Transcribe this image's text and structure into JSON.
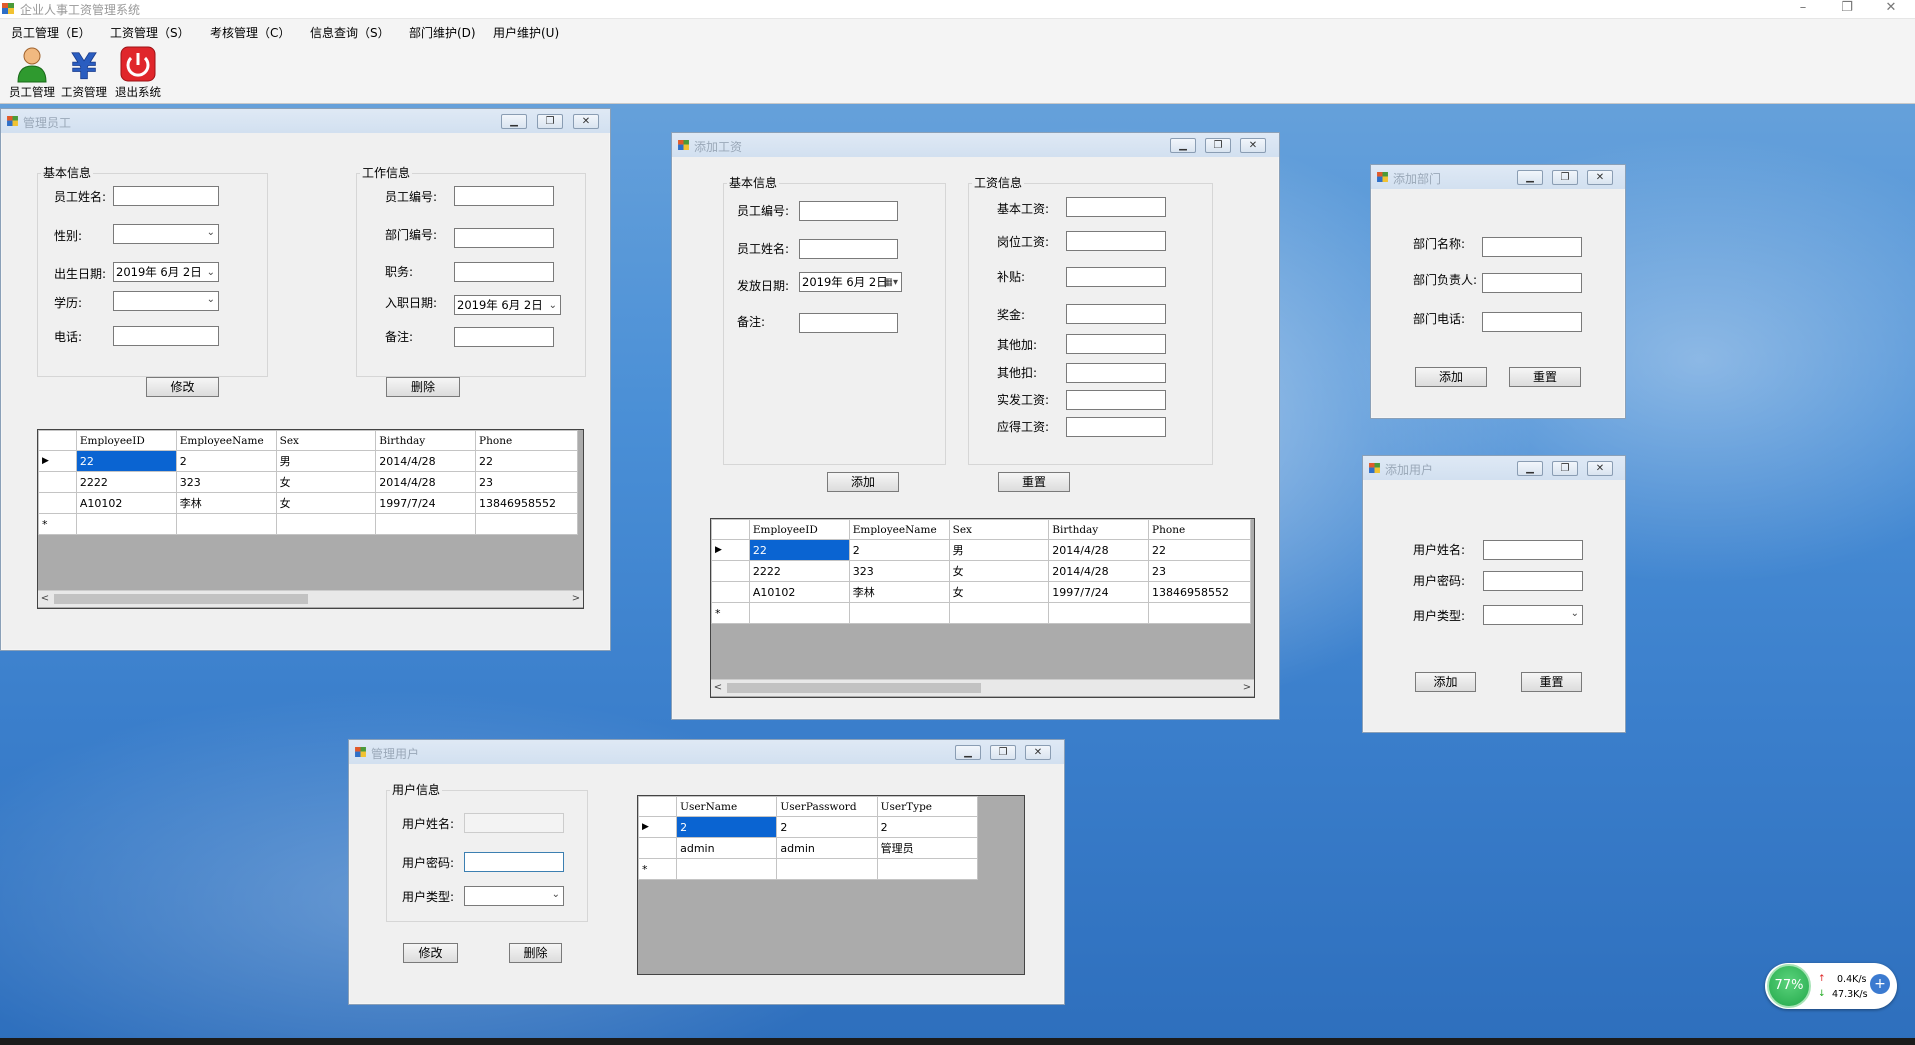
{
  "app": {
    "title": "企业人事工资管理系统",
    "window_controls": [
      "–",
      "❐",
      "✕"
    ]
  },
  "menu": [
    "员工管理（E）",
    "工资管理（S）",
    "考核管理（C）",
    "信息查询（S）",
    "部门维护(D)",
    "用户维护(U)"
  ],
  "toolbar": [
    {
      "label": "员工管理",
      "icon": "person-icon"
    },
    {
      "label": "工资管理",
      "icon": "yen-icon"
    },
    {
      "label": "退出系统",
      "icon": "power-icon"
    }
  ],
  "manage_employee": {
    "title": "管理员工",
    "basic_group": "基本信息",
    "work_group": "工作信息",
    "labels": {
      "name": "员工姓名:",
      "gender": "性别:",
      "birth": "出生日期:",
      "education": "学历:",
      "phone": "电话:",
      "emp_no": "员工编号:",
      "dept_no": "部门编号:",
      "position": "职务:",
      "hire_date": "入职日期:",
      "remark": "备注:"
    },
    "birth_value": "2019年 6月 2日",
    "hire_value": "2019年 6月 2日",
    "modify_btn": "修改",
    "delete_btn": "删除"
  },
  "employee_grid": {
    "columns": [
      "EmployeeID",
      "EmployeeName",
      "Sex",
      "Birthday",
      "Phone"
    ],
    "rows": [
      [
        "22",
        "2",
        "男",
        "2014/4/28",
        "22"
      ],
      [
        "2222",
        "323",
        "女",
        "2014/4/28",
        "23"
      ],
      [
        "A10102",
        "李林",
        "女",
        "1997/7/24",
        "13846958552"
      ]
    ],
    "new_row_marker": "*",
    "current_row_marker": "▶"
  },
  "add_salary": {
    "title": "添加工资",
    "basic_group": "基本信息",
    "salary_group": "工资信息",
    "labels": {
      "emp_no": "员工编号:",
      "emp_name": "员工姓名:",
      "pay_date": "发放日期:",
      "remark": "备注:",
      "base": "基本工资:",
      "post": "岗位工资:",
      "subsidy": "补贴:",
      "bonus": "奖金:",
      "other_add": "其他加:",
      "other_deduct": "其他扣:",
      "actual": "实发工资:",
      "payable": "应得工资:"
    },
    "pay_date_value": "2019年 6月 2日",
    "add_btn": "添加",
    "reset_btn": "重置"
  },
  "add_department": {
    "title": "添加部门",
    "labels": {
      "name": "部门名称:",
      "manager": "部门负责人:",
      "phone": "部门电话:"
    },
    "add_btn": "添加",
    "reset_btn": "重置"
  },
  "add_user": {
    "title": "添加用户",
    "labels": {
      "name": "用户姓名:",
      "password": "用户密码:",
      "type": "用户类型:"
    },
    "add_btn": "添加",
    "reset_btn": "重置"
  },
  "manage_user": {
    "title": "管理用户",
    "group": "用户信息",
    "labels": {
      "name": "用户姓名:",
      "password": "用户密码:",
      "type": "用户类型:"
    },
    "modify_btn": "修改",
    "delete_btn": "删除"
  },
  "user_grid": {
    "columns": [
      "UserName",
      "UserPassword",
      "UserType"
    ],
    "rows": [
      [
        "2",
        "2",
        "2"
      ],
      [
        "admin",
        "admin",
        "管理员"
      ]
    ]
  },
  "tray": {
    "percent": "77%",
    "upload": "0.4K/s",
    "download": "47.3K/s"
  }
}
